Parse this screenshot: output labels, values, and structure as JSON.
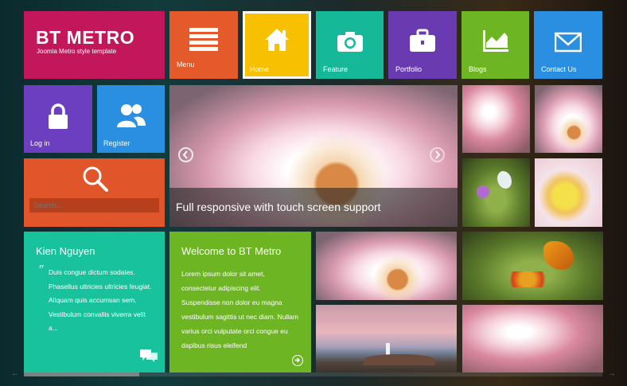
{
  "brand": {
    "title": "BT METRO",
    "subtitle": "Joomla Metro style template",
    "color": "#c2185b"
  },
  "nav": [
    {
      "label": "Menu",
      "icon": "menu-icon",
      "color": "#e55a2b"
    },
    {
      "label": "Home",
      "icon": "home-icon",
      "color": "#f7c000"
    },
    {
      "label": "Feature",
      "icon": "camera-icon",
      "color": "#15b99a"
    },
    {
      "label": "Portfolio",
      "icon": "briefcase-icon",
      "color": "#6a3bb0"
    },
    {
      "label": "Blogs",
      "icon": "chart-icon",
      "color": "#6eb524"
    },
    {
      "label": "Contact Us",
      "icon": "mail-icon",
      "color": "#2a8fe0"
    }
  ],
  "account": {
    "login_label": "Log in",
    "login_color": "#6b3fc0",
    "register_label": "Register",
    "register_color": "#2a8fe0"
  },
  "search": {
    "placeholder": "Search...",
    "color": "#e0562a"
  },
  "slider": {
    "caption": "Full responsive with touch screen support",
    "prev_icon": "chevron-left-icon",
    "next_icon": "chevron-right-icon"
  },
  "testimonial": {
    "name": "Kien Nguyen",
    "quote": "Duis congue dictum sodales. Phasellus ultricies ultricies feugiat. Aliquam quis accumsan sem. Vestibulum convallis viverra velit a...",
    "color": "#18c29c"
  },
  "welcome": {
    "title": "Welcome to BT Metro",
    "body": "Lorem ipsum dolor sit amet, consectetur adipiscing elit. Suspendisse non dolor eu magna vestibulum sagittis ut nec diam. Nullam varius orci vulputate orci congue eu dapibus risus eleifend",
    "color": "#6eb524"
  }
}
